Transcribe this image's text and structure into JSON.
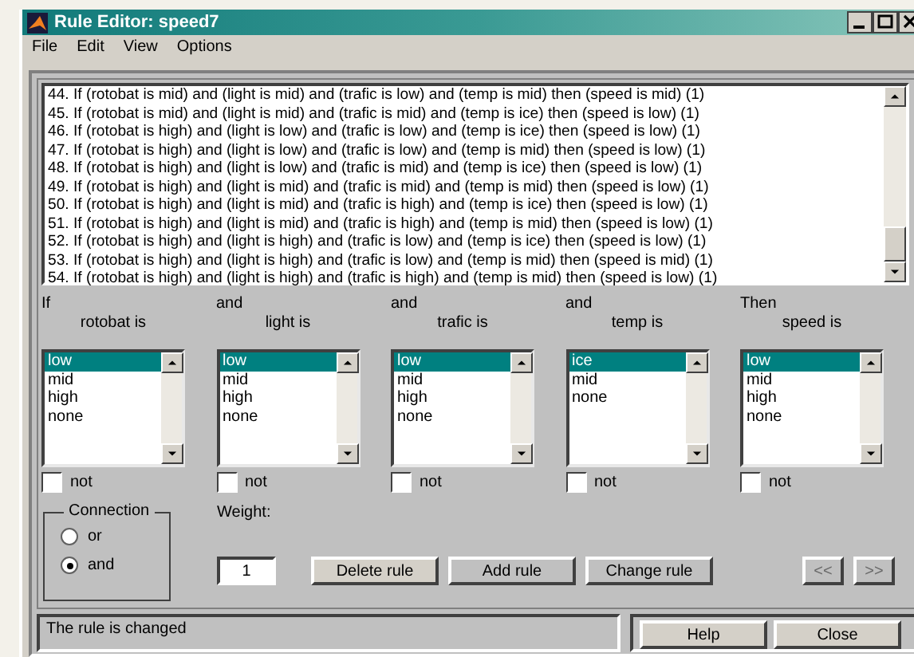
{
  "window": {
    "title": "Rule Editor: speed7"
  },
  "menu": [
    "File",
    "Edit",
    "View",
    "Options"
  ],
  "rules": [
    "44. If (rotobat is mid) and (light is mid) and (trafic is low) and (temp is mid) then (speed is mid) (1)",
    "45. If (rotobat is mid) and (light is mid) and (trafic is mid) and (temp is ice) then (speed is low) (1)",
    "46. If (rotobat is high) and (light is low) and (trafic is low) and (temp is ice) then (speed is low) (1)",
    "47. If (rotobat is high) and (light is low) and (trafic is low) and (temp is mid) then (speed is low) (1)",
    "48. If (rotobat is high) and (light is low) and (trafic is mid) and (temp is ice) then (speed is low) (1)",
    "49. If (rotobat is high) and (light is mid) and (trafic is mid) and (temp is mid) then (speed is low) (1)",
    "50. If (rotobat is high) and (light is mid) and (trafic is high) and (temp is ice) then (speed is low) (1)",
    "51. If (rotobat is high) and (light is mid) and (trafic is high) and (temp is mid) then (speed is low) (1)",
    "52. If (rotobat is high) and (light is high) and (trafic is low) and (temp is ice) then (speed is low) (1)",
    "53. If (rotobat is high) and (light is high) and (trafic is low) and (temp is mid) then (speed is mid) (1)",
    "54. If (rotobat is high) and (light is high) and (trafic is high) and (temp is mid) then (speed is low) (1)"
  ],
  "variables": [
    {
      "connector": "If",
      "label": "rotobat is",
      "items": [
        {
          "label": "low",
          "selected": true
        },
        {
          "label": "mid",
          "selected": false
        },
        {
          "label": "high",
          "selected": false
        },
        {
          "label": "none",
          "selected": false
        }
      ],
      "not_label": "not",
      "not_checked": false
    },
    {
      "connector": "and",
      "label": "light is",
      "items": [
        {
          "label": "low",
          "selected": true
        },
        {
          "label": "mid",
          "selected": false
        },
        {
          "label": "high",
          "selected": false
        },
        {
          "label": "none",
          "selected": false
        }
      ],
      "not_label": "not",
      "not_checked": false
    },
    {
      "connector": "and",
      "label": "trafic is",
      "items": [
        {
          "label": "low",
          "selected": true
        },
        {
          "label": "mid",
          "selected": false
        },
        {
          "label": "high",
          "selected": false
        },
        {
          "label": "none",
          "selected": false
        }
      ],
      "not_label": "not",
      "not_checked": false
    },
    {
      "connector": "and",
      "label": "temp is",
      "items": [
        {
          "label": "ice",
          "selected": true
        },
        {
          "label": "mid",
          "selected": false
        },
        {
          "label": "none",
          "selected": false
        }
      ],
      "not_label": "not",
      "not_checked": false
    },
    {
      "connector": "Then",
      "label": "speed is",
      "items": [
        {
          "label": "low",
          "selected": true
        },
        {
          "label": "mid",
          "selected": false
        },
        {
          "label": "high",
          "selected": false
        },
        {
          "label": "none",
          "selected": false
        }
      ],
      "not_label": "not",
      "not_checked": false
    }
  ],
  "connection": {
    "title": "Connection",
    "options": [
      {
        "label": "or",
        "selected": false
      },
      {
        "label": "and",
        "selected": true
      }
    ]
  },
  "weight": {
    "label": "Weight:",
    "value": "1"
  },
  "buttons": [
    {
      "label": "Delete rule",
      "disabled": false,
      "focused": true
    },
    {
      "label": "Add rule",
      "disabled": false,
      "focused": false
    },
    {
      "label": "Change rule",
      "disabled": false,
      "focused": false
    }
  ],
  "nav_buttons": [
    {
      "label": "<<",
      "disabled": true
    },
    {
      "label": ">>",
      "disabled": true
    }
  ],
  "status": "The rule is changed",
  "footer_buttons": [
    "Help",
    "Close"
  ]
}
